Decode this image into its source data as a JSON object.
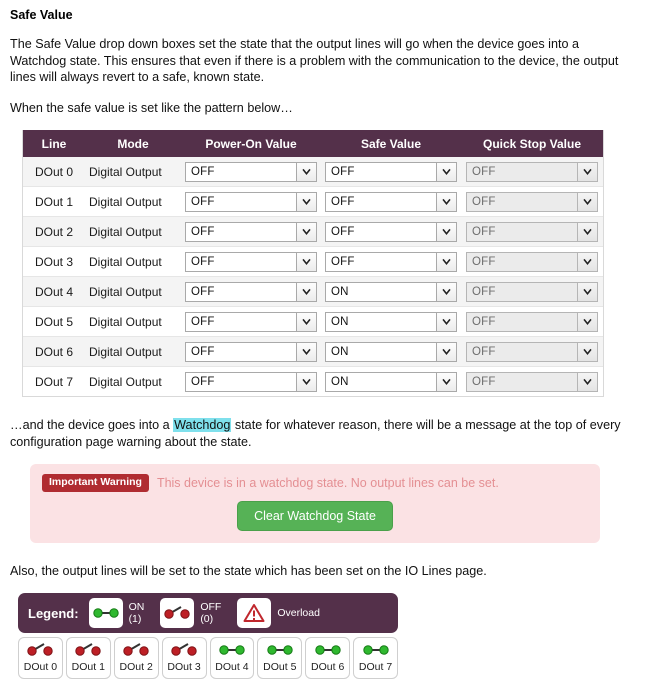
{
  "section": {
    "title": "Safe Value",
    "paragraph1": "The Safe Value drop down boxes set the state that the output lines will go when the device goes into a Watchdog state. This ensures that even if there is a problem with the communication to the device, the output lines will always revert to a safe, known state.",
    "paragraph2": "When the safe value is set like the pattern below…",
    "paragraph3_part1": "…and the device goes into a ",
    "paragraph3_highlight": "Watchdog",
    "paragraph3_part2": " state for whatever reason, there will be a message at the top of every configuration page warning about the state.",
    "paragraph4": "Also, the output lines will be set to the state which has been set on the IO Lines page."
  },
  "io_table": {
    "headers": [
      "Line",
      "Mode",
      "Power-On Value",
      "Safe Value",
      "Quick Stop Value"
    ],
    "rows": [
      {
        "line": "DOut 0",
        "mode": "Digital Output",
        "power_on": "OFF",
        "safe": "OFF",
        "quick_stop": "OFF",
        "quick_stop_disabled": true
      },
      {
        "line": "DOut 1",
        "mode": "Digital Output",
        "power_on": "OFF",
        "safe": "OFF",
        "quick_stop": "OFF",
        "quick_stop_disabled": true
      },
      {
        "line": "DOut 2",
        "mode": "Digital Output",
        "power_on": "OFF",
        "safe": "OFF",
        "quick_stop": "OFF",
        "quick_stop_disabled": true
      },
      {
        "line": "DOut 3",
        "mode": "Digital Output",
        "power_on": "OFF",
        "safe": "OFF",
        "quick_stop": "OFF",
        "quick_stop_disabled": true
      },
      {
        "line": "DOut 4",
        "mode": "Digital Output",
        "power_on": "OFF",
        "safe": "ON",
        "quick_stop": "OFF",
        "quick_stop_disabled": true
      },
      {
        "line": "DOut 5",
        "mode": "Digital Output",
        "power_on": "OFF",
        "safe": "ON",
        "quick_stop": "OFF",
        "quick_stop_disabled": true
      },
      {
        "line": "DOut 6",
        "mode": "Digital Output",
        "power_on": "OFF",
        "safe": "ON",
        "quick_stop": "OFF",
        "quick_stop_disabled": true
      },
      {
        "line": "DOut 7",
        "mode": "Digital Output",
        "power_on": "OFF",
        "safe": "ON",
        "quick_stop": "OFF",
        "quick_stop_disabled": true
      }
    ],
    "header_bg": "#54304a"
  },
  "warning": {
    "badge": "Important Warning",
    "message": "This device is in a watchdog state. No output lines can be set.",
    "button_label": "Clear Watchdog State",
    "panel_bg": "#fbe2e4",
    "badge_bg": "#b02c31",
    "button_bg": "#56b256"
  },
  "legend": {
    "label": "Legend:",
    "items": [
      {
        "icon": "switch-closed-green-icon",
        "line1": "ON",
        "line2": "(1)"
      },
      {
        "icon": "switch-open-red-icon",
        "line1": "OFF",
        "line2": "(0)"
      },
      {
        "icon": "overload-warning-triangle-icon",
        "line1": "Overload",
        "line2": ""
      }
    ],
    "bar_bg": "#54304a"
  },
  "io_lines": {
    "cells": [
      {
        "label": "DOut 0",
        "state": "OFF"
      },
      {
        "label": "DOut 1",
        "state": "OFF"
      },
      {
        "label": "DOut 2",
        "state": "OFF"
      },
      {
        "label": "DOut 3",
        "state": "OFF"
      },
      {
        "label": "DOut 4",
        "state": "ON"
      },
      {
        "label": "DOut 5",
        "state": "ON"
      },
      {
        "label": "DOut 6",
        "state": "ON"
      },
      {
        "label": "DOut 7",
        "state": "ON"
      }
    ],
    "color_on": "#2fb82f",
    "color_off": "#bd1f25"
  }
}
